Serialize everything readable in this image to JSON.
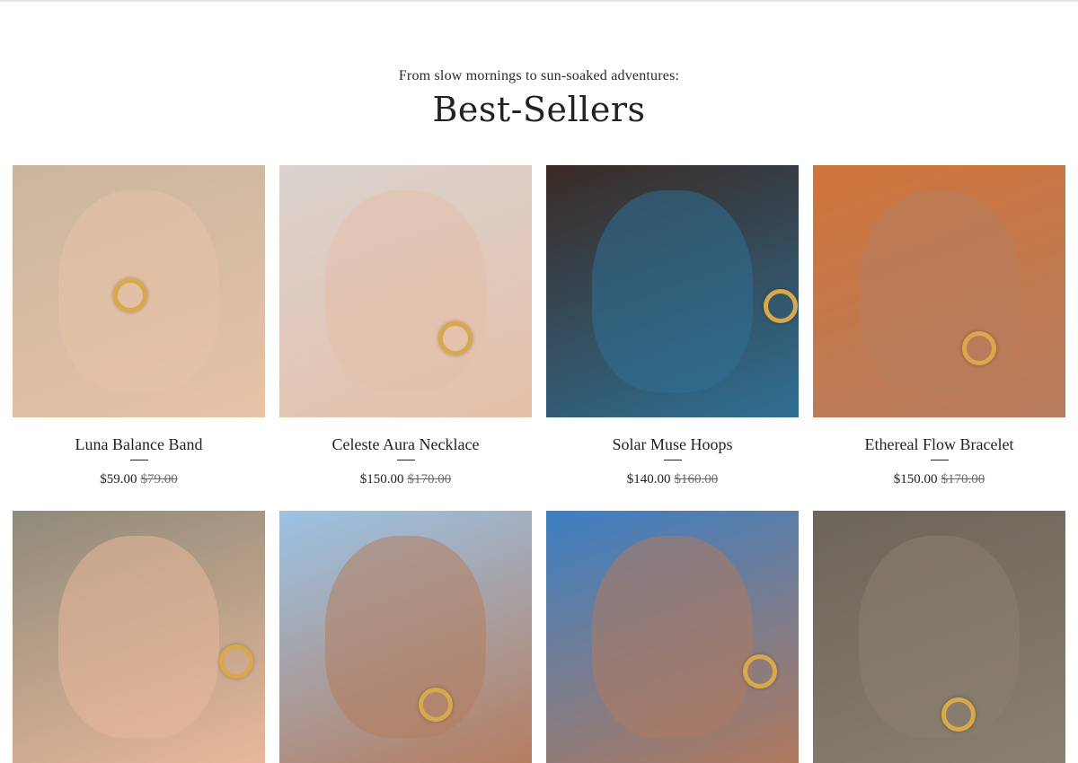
{
  "section": {
    "subtitle": "From slow mornings to sun-soaked adventures:",
    "title": "Best-Sellers"
  },
  "products": [
    {
      "name": "Luna Balance Band",
      "price": "$59.00",
      "original_price": "$79.00",
      "image": "model-with-gold-rings",
      "bg": "#c9b59f",
      "tone": "#e8c3a8"
    },
    {
      "name": "Celeste Aura Necklace",
      "price": "$150.00",
      "original_price": "$170.00",
      "image": "gold-layered-necklace",
      "bg": "#d9d2ce",
      "tone": "#e6c0a9"
    },
    {
      "name": "Solar Muse Hoops",
      "price": "$140.00",
      "original_price": "$160.00",
      "image": "blue-beaded-hoop-earrings",
      "bg": "#3a2a25",
      "tone": "#2f6f93"
    },
    {
      "name": "Ethereal Flow Bracelet",
      "price": "$150.00",
      "original_price": "$170.00",
      "image": "model-with-beaded-bracelets",
      "bg": "#d0743a",
      "tone": "#b57d5f"
    },
    {
      "name": "",
      "price": "",
      "original_price": "",
      "image": "woven-rattan-earrings",
      "bg": "#8f8a7a",
      "tone": "#e8b89a"
    },
    {
      "name": "",
      "price": "",
      "original_price": "",
      "image": "smiling-model-hoop-earrings",
      "bg": "#9bc3e6",
      "tone": "#b57d5f"
    },
    {
      "name": "",
      "price": "",
      "original_price": "",
      "image": "model-with-blue-makeup-rings",
      "bg": "#3c7fc4",
      "tone": "#b07a5e"
    },
    {
      "name": "",
      "price": "",
      "original_price": "",
      "image": "neutral-shadow-photo",
      "bg": "#6d6458",
      "tone": "#8a8070"
    }
  ]
}
